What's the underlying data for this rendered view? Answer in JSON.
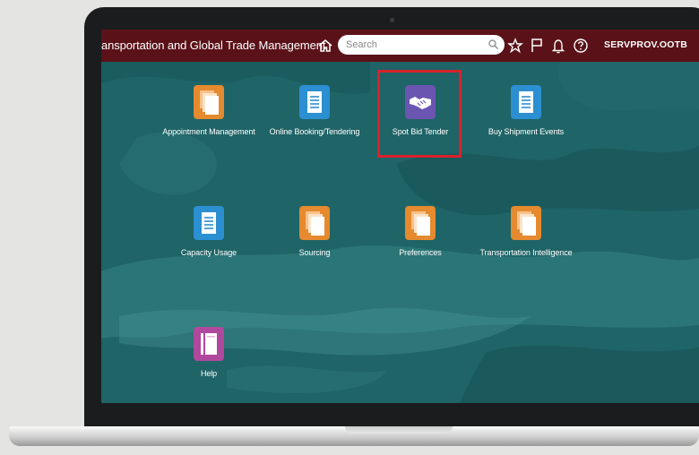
{
  "header": {
    "title": "ansportation and Global Trade Management",
    "search_placeholder": "Search",
    "user": "SERVPROV.OOTB",
    "icons": [
      "home-icon",
      "star-icon",
      "flag-icon",
      "bell-icon",
      "help-icon"
    ]
  },
  "colors": {
    "header_bg": "#5a1218",
    "screen_bg": "#1f6467",
    "orange_tile": "#e58a2e",
    "blue_tile": "#2b8fd1",
    "purple_tile": "#6a55b0",
    "pink_tile": "#b0489e",
    "highlight": "#d8222c"
  },
  "tiles": [
    {
      "label": "Appointment Management",
      "icon": "stack-icon",
      "color": "orange"
    },
    {
      "label": "Online Booking/Tendering",
      "icon": "document-icon",
      "color": "blue"
    },
    {
      "label": "Spot Bid Tender",
      "icon": "handshake-icon",
      "color": "purple",
      "highlighted": true
    },
    {
      "label": "Buy Shipment Events",
      "icon": "document-icon",
      "color": "blue"
    },
    {
      "label": "Capacity Usage",
      "icon": "document-icon",
      "color": "blue"
    },
    {
      "label": "Sourcing",
      "icon": "stack-icon",
      "color": "orange"
    },
    {
      "label": "Preferences",
      "icon": "stack-icon",
      "color": "orange"
    },
    {
      "label": "Transportation Intelligence",
      "icon": "stack-icon",
      "color": "orange"
    },
    {
      "label": "Help",
      "icon": "book-icon",
      "color": "pink"
    }
  ]
}
